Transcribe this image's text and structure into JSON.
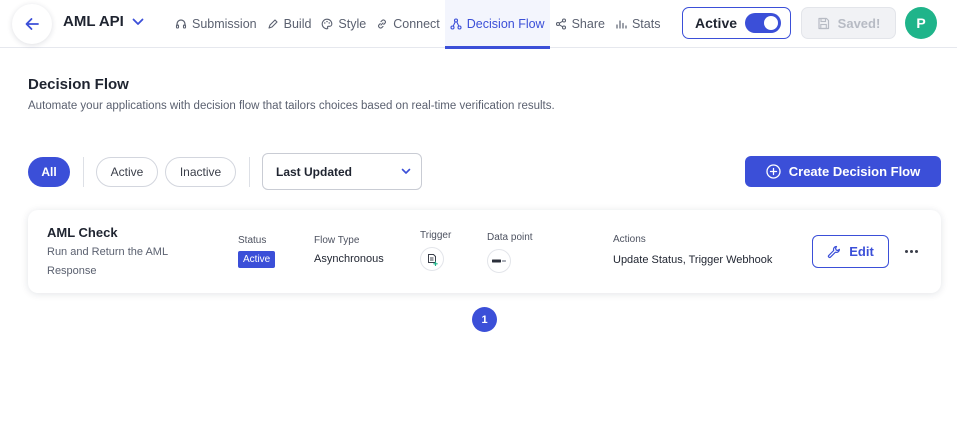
{
  "header": {
    "app_title": "AML API",
    "tabs": [
      {
        "label": "Submission",
        "icon": "headset-icon"
      },
      {
        "label": "Build",
        "icon": "pencil-icon"
      },
      {
        "label": "Style",
        "icon": "palette-icon"
      },
      {
        "label": "Connect",
        "icon": "link-icon"
      },
      {
        "label": "Decision Flow",
        "icon": "flow-icon",
        "active": true
      },
      {
        "label": "Share",
        "icon": "share-icon"
      },
      {
        "label": "Stats",
        "icon": "stats-icon"
      }
    ],
    "active_toggle_label": "Active",
    "active_toggle_on": true,
    "saved_label": "Saved!",
    "avatar_initial": "P"
  },
  "page": {
    "title": "Decision Flow",
    "description": "Automate your applications with decision flow that tailors choices based on real-time verification results."
  },
  "filters": {
    "all": "All",
    "active": "Active",
    "inactive": "Inactive",
    "sort_selected": "Last Updated",
    "create_button": "Create Decision Flow"
  },
  "flows": [
    {
      "name": "AML Check",
      "description": "Run and Return the AML Response",
      "status_label": "Status",
      "status": "Active",
      "flow_type_label": "Flow Type",
      "flow_type": "Asynchronous",
      "trigger_label": "Trigger",
      "data_point_label": "Data point",
      "actions_label": "Actions",
      "actions": "Update Status, Trigger Webhook",
      "edit_label": "Edit"
    }
  ],
  "pagination": {
    "current_page": "1"
  },
  "colors": {
    "accent": "#3b4fd8",
    "avatar": "#1fb48a"
  }
}
